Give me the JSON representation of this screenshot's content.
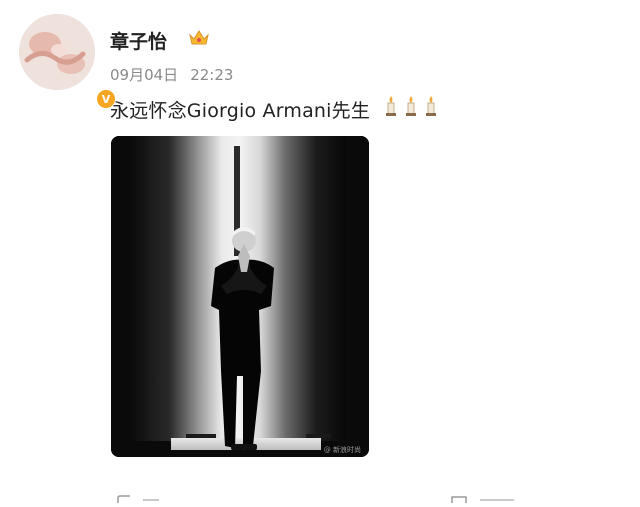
{
  "post": {
    "username": "章子怡",
    "date": "09月04日",
    "time": "22:23",
    "text": "永远怀念Giorgio Armani先生",
    "verified_mark": "V",
    "icons": [
      "crown-icon",
      "candle-icon",
      "candle-icon",
      "candle-icon"
    ]
  },
  "photo": {
    "watermark": "@ 新浪时尚"
  },
  "colors": {
    "verified": "#f5a623",
    "text": "#222222",
    "muted": "#8a8a8a"
  }
}
